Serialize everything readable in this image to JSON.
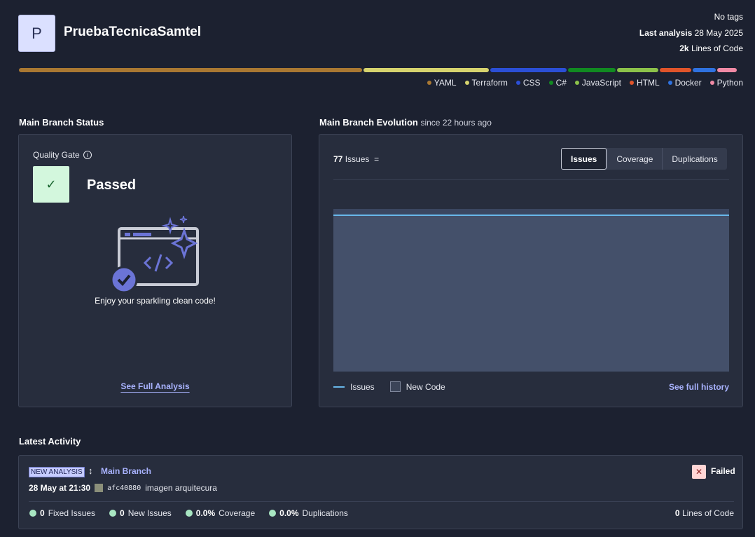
{
  "project": {
    "avatar_letter": "P",
    "name": "PruebaTecnicaSamtel",
    "tags": "No tags",
    "last_analysis_label": "Last analysis",
    "last_analysis_date": "28 May 2025",
    "loc_value": "2k",
    "loc_label": "Lines of Code"
  },
  "languages": [
    {
      "name": "YAML",
      "color": "#a97832",
      "share": 0.48
    },
    {
      "name": "Terraform",
      "color": "#d6d36e",
      "share": 0.175
    },
    {
      "name": "CSS",
      "color": "#2b4fd6",
      "share": 0.107
    },
    {
      "name": "C#",
      "color": "#118a21",
      "share": 0.067
    },
    {
      "name": "JavaScript",
      "color": "#8cc24a",
      "share": 0.058
    },
    {
      "name": "HTML",
      "color": "#e0542a",
      "share": 0.044
    },
    {
      "name": "Docker",
      "color": "#2f72e0",
      "share": 0.032
    },
    {
      "name": "Python",
      "color": "#f08aa5",
      "share": 0.027
    }
  ],
  "main_status": {
    "title": "Main Branch Status",
    "quality_gate_label": "Quality Gate",
    "status": "Passed",
    "message": "Enjoy your sparkling clean code!",
    "see_full_analysis": "See Full Analysis"
  },
  "evolution": {
    "title": "Main Branch Evolution",
    "since": "since 22 hours ago",
    "issues_count": "77",
    "issues_label": "Issues",
    "tabs": [
      "Issues",
      "Coverage",
      "Duplications"
    ],
    "active_tab": "Issues",
    "legend_issues": "Issues",
    "legend_new_code": "New Code",
    "see_history": "See full history",
    "series_color": "#68b7ea"
  },
  "activity": {
    "title": "Latest Activity",
    "badge": "NEW ANALYSIS",
    "branch": "Main Branch",
    "status": "Failed",
    "date": "28 May at 21:30",
    "commit_sha": "afc40880",
    "commit_message": "imagen arquitecura",
    "metrics": [
      {
        "value": "0",
        "label": "Fixed Issues"
      },
      {
        "value": "0",
        "label": "New Issues"
      },
      {
        "value": "0.0%",
        "label": "Coverage"
      },
      {
        "value": "0.0%",
        "label": "Duplications"
      }
    ],
    "loc_value": "0",
    "loc_label": "Lines of Code"
  }
}
